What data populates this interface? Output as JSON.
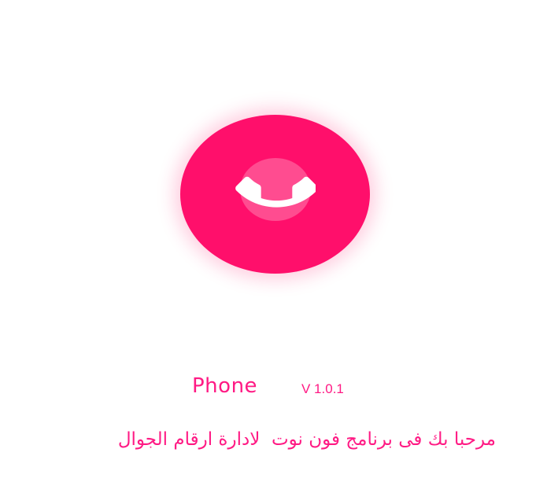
{
  "app": {
    "name": "Phone",
    "version": "V 1.0.1",
    "welcome_message": "مرحبا بك فى برنامج فون نوت  لادارة ارقام الجوال"
  },
  "colors": {
    "brand_pink": "#ff0f6b",
    "inner_circle": "#ff4c90",
    "text_pink": "#ff1a84",
    "icon_white": "#ffffff"
  },
  "icons": {
    "logo": "phone-handset-icon"
  }
}
